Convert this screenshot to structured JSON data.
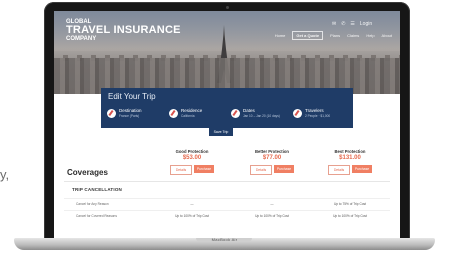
{
  "edge": {
    "text": "y,"
  },
  "base_label": "MacBook Air",
  "site": {
    "logo": {
      "line1": "GLOBAL",
      "line2": "TRAVEL INSURANCE",
      "line3": "COMPANY"
    },
    "top_icons": [
      "✉",
      "✆",
      "☰",
      "Login"
    ],
    "nav": [
      "Home",
      "Get a Quote",
      "Plans",
      "Claims",
      "Help",
      "About"
    ],
    "nav_active_index": 1
  },
  "edit_trip": {
    "title": "Edit Your Trip",
    "steps": [
      {
        "label": "Destination",
        "value": "France (Paris)"
      },
      {
        "label": "Residence",
        "value": "California"
      },
      {
        "label": "Dates",
        "value": "Jan 10 – Jan 20 (10 days)"
      },
      {
        "label": "Travelers",
        "value": "2 People · $1,000"
      }
    ],
    "save_button": "Save Trip"
  },
  "plans": {
    "heading": "Coverages",
    "items": [
      {
        "name": "Good Protection",
        "price": "$53.00",
        "details": "Details",
        "purchase": "Purchase"
      },
      {
        "name": "Better Protection",
        "price": "$77.00",
        "details": "Details",
        "purchase": "Purchase"
      },
      {
        "name": "Best Protection",
        "price": "$131.00",
        "details": "Details",
        "purchase": "Purchase"
      }
    ],
    "section": "TRIP CANCELLATION",
    "rows": [
      {
        "label": "Cancel for Any Reason",
        "values": [
          "—",
          "—",
          "Up to 75% of Trip Cost"
        ]
      },
      {
        "label": "Cancel for Covered Reasons",
        "values": [
          "Up to 100% of Trip Cost",
          "Up to 100% of Trip Cost",
          "Up to 100% of Trip Cost"
        ]
      }
    ]
  },
  "colors": {
    "navy": "#1f3c67",
    "accent": "#f07f63",
    "price": "#e56a4f"
  }
}
